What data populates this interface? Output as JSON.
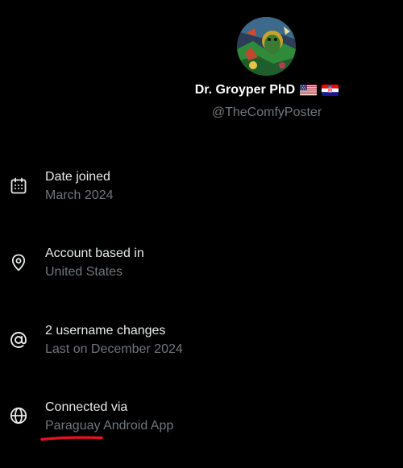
{
  "profile": {
    "display_name": "Dr. Groyper PhD",
    "handle": "@TheComfyPoster",
    "flags": [
      "us-flag-icon",
      "croatia-flag-icon"
    ]
  },
  "info": {
    "joined": {
      "title": "Date joined",
      "value": "March 2024",
      "icon": "calendar-icon"
    },
    "based": {
      "title": "Account based in",
      "value": "United States",
      "icon": "location-pin-icon"
    },
    "username": {
      "title": "2 username changes",
      "value": "Last on December 2024",
      "icon": "at-sign-icon"
    },
    "connected": {
      "title": "Connected via",
      "value_country": "Paraguay",
      "value_app": " Android App",
      "icon": "globe-icon"
    }
  },
  "annotation": {
    "color": "#e0141e",
    "target": "Paraguay"
  },
  "colors": {
    "background": "#000000",
    "primary_text": "#e7e9ea",
    "secondary_text": "#71767b"
  }
}
